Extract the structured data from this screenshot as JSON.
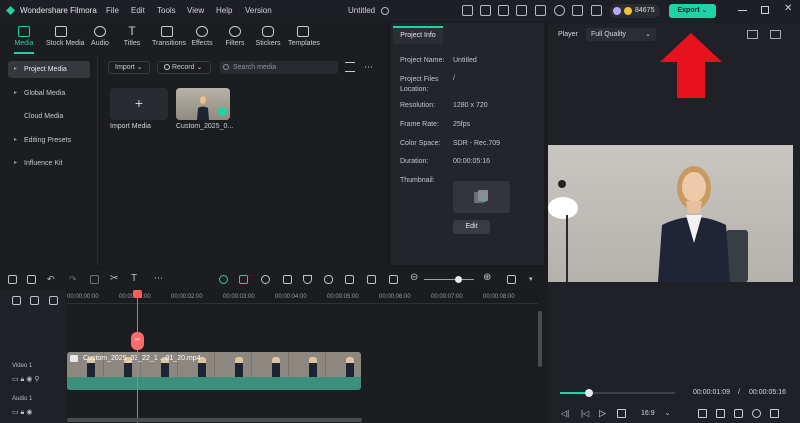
{
  "app": {
    "title": "Wondershare Filmora",
    "doc_title": "Untitled",
    "credits": "84675",
    "export_label": "Export"
  },
  "menu": [
    "File",
    "Edit",
    "Tools",
    "View",
    "Help",
    "Version"
  ],
  "tabs": [
    {
      "label": "Media",
      "active": true
    },
    {
      "label": "Stock Media"
    },
    {
      "label": "Audio"
    },
    {
      "label": "Titles"
    },
    {
      "label": "Transitions"
    },
    {
      "label": "Effects"
    },
    {
      "label": "Filters"
    },
    {
      "label": "Stickers"
    },
    {
      "label": "Templates"
    }
  ],
  "sidebar": {
    "items": [
      {
        "label": "Project Media",
        "selected": true,
        "caret": "▸"
      },
      {
        "label": "Global Media",
        "caret": "▸"
      },
      {
        "label": "Cloud Media",
        "caret": ""
      },
      {
        "label": "Editing Presets",
        "caret": "▸"
      },
      {
        "label": "Influence Kit",
        "caret": "▸"
      }
    ]
  },
  "media_toolbar": {
    "import_label": "Import",
    "record_label": "Record",
    "search_placeholder": "Search media"
  },
  "media_items": [
    {
      "label": "Import Media",
      "icon": "+"
    },
    {
      "label": "Custom_2025_0..."
    }
  ],
  "project_info": {
    "tab_label": "Project Info",
    "fields": [
      {
        "key": "Project Name:",
        "value": "Untitled"
      },
      {
        "key": "Project Files Location:",
        "value": "/"
      },
      {
        "key": "Resolution:",
        "value": "1280 x 720"
      },
      {
        "key": "Frame Rate:",
        "value": "25fps"
      },
      {
        "key": "Color Space:",
        "value": "SDR - Rec.709"
      },
      {
        "key": "Duration:",
        "value": "00:00:05:16"
      },
      {
        "key": "Thumbnail:",
        "value": ""
      }
    ],
    "edit_label": "Edit"
  },
  "player": {
    "label": "Player",
    "quality": "Full Quality",
    "current_time": "00:00:01:09",
    "separator": "/",
    "total_time": "00:00:05:16",
    "ratio": "16:9",
    "progress": 0.25
  },
  "timeline": {
    "ruler": [
      "00:00:00:00",
      "00:00:01:00",
      "00:00:02:00",
      "00:00:03:00",
      "00:00:04:00",
      "00:00:05:00",
      "00:00:06:00",
      "00:00:07:00",
      "00:00:08:00"
    ],
    "tracks": [
      {
        "label": "Video 1"
      },
      {
        "label": "Audio 1"
      }
    ],
    "clip_name": "Custom_2025_03_22_1 ...01_20.mp4"
  },
  "colors": {
    "accent": "#1ed3a6",
    "playhead": "#ff5a5a",
    "arrow": "#e8121f"
  }
}
